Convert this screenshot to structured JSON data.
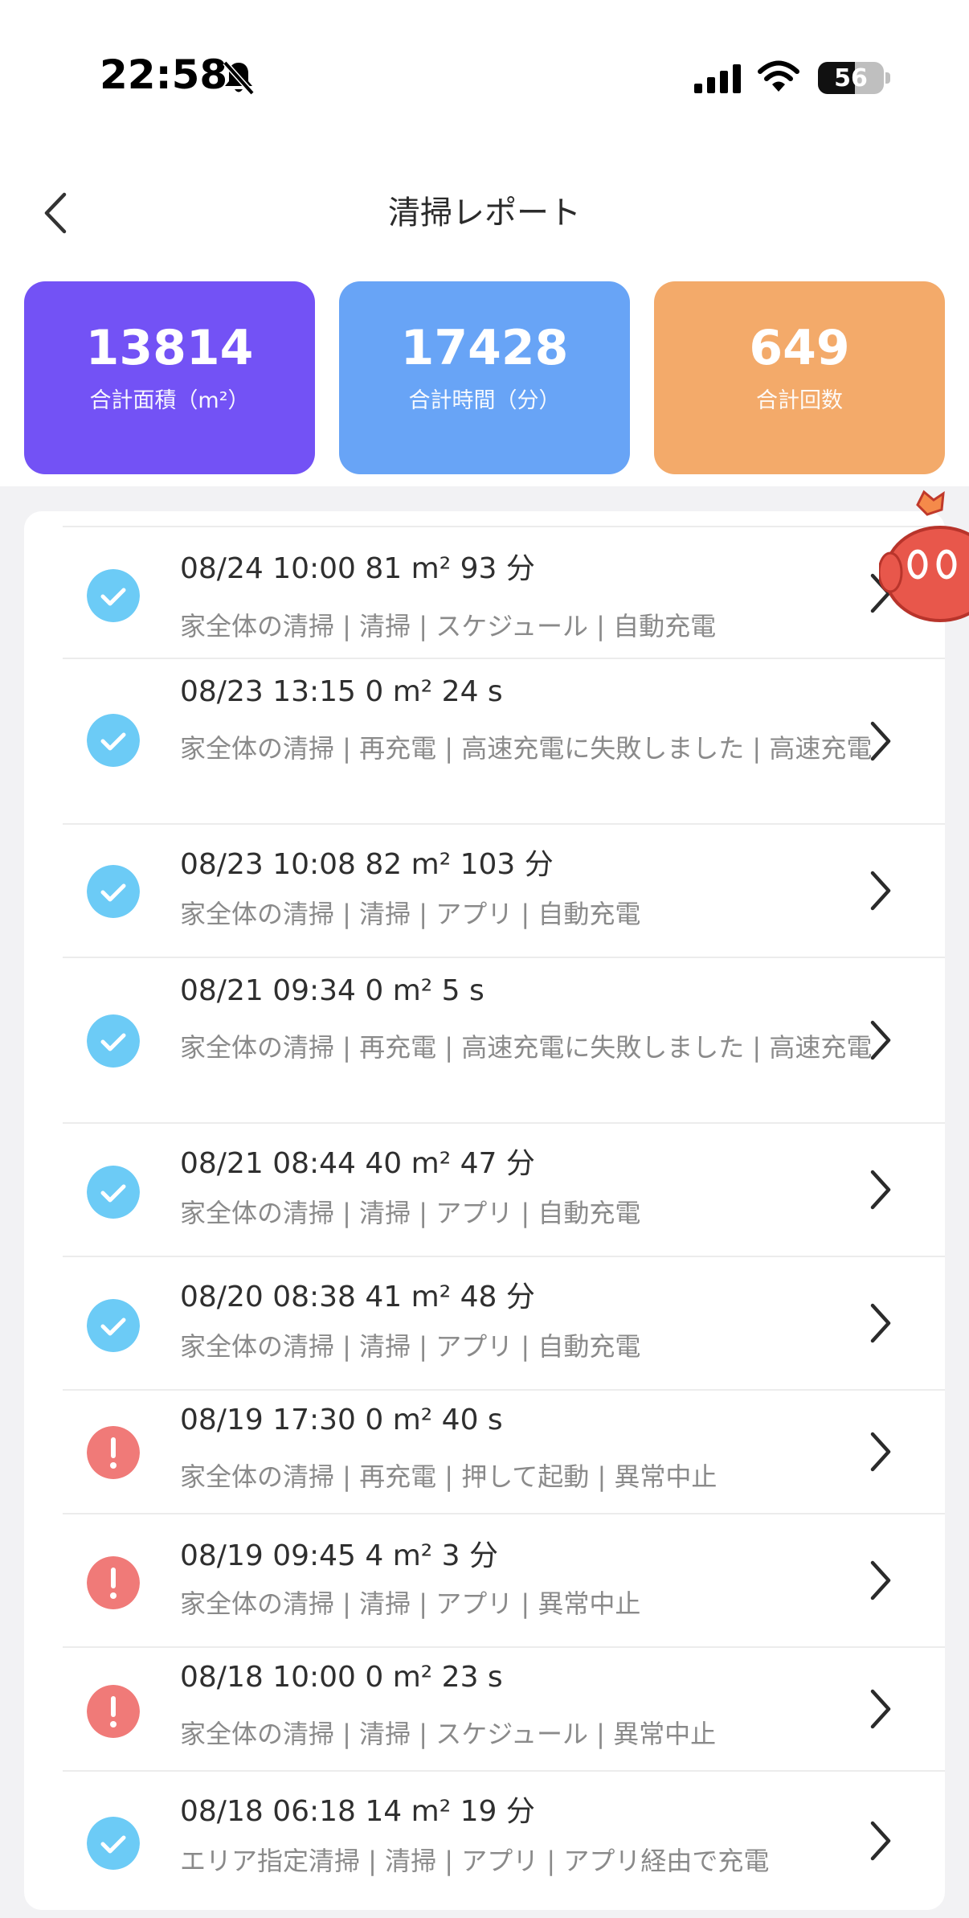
{
  "status_bar": {
    "time": "22:58",
    "battery": "56",
    "battery_level": 0.56
  },
  "header": {
    "title": "清掃レポート"
  },
  "stats": [
    {
      "value": "13814",
      "label": "合計面積（m²）",
      "color": "#7352f5"
    },
    {
      "value": "17428",
      "label": "合計時間（分）",
      "color": "#68a4f6"
    },
    {
      "value": "649",
      "label": "合計回数",
      "color": "#f3aa6a"
    }
  ],
  "colors": {
    "success": "#6ccbf6",
    "error": "#f07a78",
    "chevron": "#2b2b2b"
  },
  "records": [
    {
      "title": "08/24 10:00 81 m² 93 分",
      "detail": "家全体の清掃 | 清掃 | スケジュール | 自動充電",
      "status": "success"
    },
    {
      "title": "08/23 13:15 0 m² 24 s",
      "detail": "家全体の清掃 | 再充電 | 高速充電に失敗しました | 高速充電",
      "status": "success"
    },
    {
      "title": "08/23 10:08 82 m² 103 分",
      "detail": "家全体の清掃 | 清掃 | アプリ | 自動充電",
      "status": "success"
    },
    {
      "title": "08/21 09:34 0 m² 5 s",
      "detail": "家全体の清掃 | 再充電 | 高速充電に失敗しました | 高速充電",
      "status": "success"
    },
    {
      "title": "08/21 08:44 40 m² 47 分",
      "detail": "家全体の清掃 | 清掃 | アプリ | 自動充電",
      "status": "success"
    },
    {
      "title": "08/20 08:38 41 m² 48 分",
      "detail": "家全体の清掃 | 清掃 | アプリ | 自動充電",
      "status": "success"
    },
    {
      "title": "08/19 17:30 0 m² 40 s",
      "detail": "家全体の清掃 | 再充電 | 押して起動 | 異常中止",
      "status": "error"
    },
    {
      "title": "08/19 09:45 4 m² 3 分",
      "detail": "家全体の清掃 | 清掃 | アプリ | 異常中止",
      "status": "error"
    },
    {
      "title": "08/18 10:00 0 m² 23 s",
      "detail": "家全体の清掃 | 清掃 | スケジュール | 異常中止",
      "status": "error"
    },
    {
      "title": "08/18 06:18 14 m² 19 分",
      "detail": "エリア指定清掃 | 清掃 | アプリ | アプリ経由で充電",
      "status": "success"
    }
  ]
}
